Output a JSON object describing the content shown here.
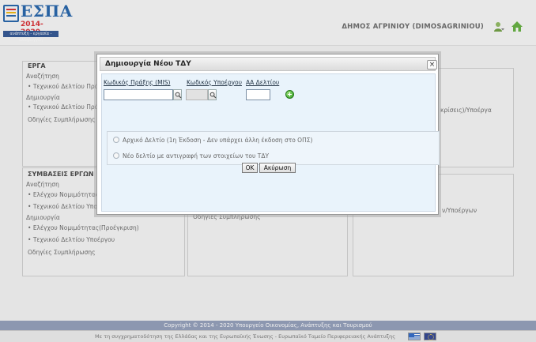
{
  "header": {
    "logo_title": "ΕΣΠΑ",
    "logo_years": "2014-2020",
    "logo_subtitle": "ανάπτυξη - εργασία - αλληλεγγύη",
    "municipality": "ΔΗΜΟΣ ΑΓΡΙΝΙΟΥ (DIMOSAGRINIOU)",
    "icons": [
      "user-menu-icon",
      "home-icon"
    ]
  },
  "panels": {
    "erga": {
      "title": "ΕΡΓΑ",
      "lines": [
        "Αναζήτηση",
        "Τεχνικού Δελτίου Πράξ",
        "Δημιουργία",
        "Τεχνικού Δελτίου Πράξ",
        "Οδηγίες Συμπλήρωσης"
      ]
    },
    "right_top": {
      "text": "κρίσεις)/Υποέργα"
    },
    "symvaseis": {
      "title": "ΣΥΜΒΑΣΕΙΣ ΕΡΓΩΝ",
      "lines": [
        "Αναζήτηση",
        "Ελέγχου Νομιμότητας",
        "Τεχνικού Δελτίου Υποέ",
        "Δημιουργία",
        "Ελέγχου Νομιμότητας(Προέγκριση)",
        "Τεχνικού Δελτίου Υποέργου",
        "Οδηγίες Συμπλήρωσης"
      ]
    },
    "middle_bottom": {
      "text": "Οδηγίες Συμπλήρωσης"
    },
    "right_bottom": {
      "text": "ν/Υποέργων"
    }
  },
  "dialog": {
    "title": "Δημιουργία Νέου ΤΔΥ",
    "close_label": "×",
    "fields": {
      "mis_label": "Κωδικός Πράξης (MIS)",
      "mis_value": "",
      "subproject_label": "Κωδικός Υποέργου",
      "subproject_value": "",
      "aa_label": "ΑΑ Δελτίου",
      "aa_value": ""
    },
    "options": [
      "Αρχικό Δελτίο (1η Έκδοση - Δεν υπάρχει άλλη έκδοση στο ΟΠΣ)",
      "Νέο δελτίο με αντιγραφή των στοιχείων του ΤΔΥ"
    ],
    "ok_label": "OK",
    "cancel_label": "Ακύρωση"
  },
  "footer": {
    "copyright": "Copyright © 2014 - 2020 Υπουργείο Οικονομίας, Ανάπτυξης και Τουρισμού",
    "cofinance": "Με τη συγχρηματοδότηση της Ελλάδας και της Ευρωπαϊκής Ένωσης - Ευρωπαϊκό Ταμείο Περιφερειακής Ανάπτυξης"
  }
}
